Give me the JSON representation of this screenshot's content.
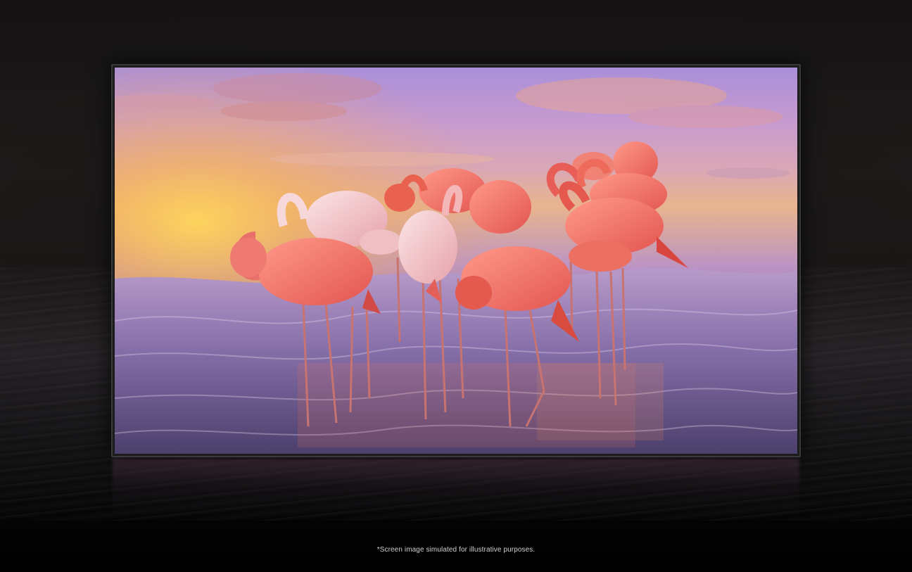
{
  "disclaimer": "*Screen image simulated for illustrative purposes.",
  "product_image": {
    "subject": "flamingos",
    "colors": {
      "sky_top": "#a98fd8",
      "sky_glow": "#f7c25a",
      "flamingo_pink": "#f07a7a",
      "flamingo_light": "#f3c4c8",
      "water": "#6c5c90"
    }
  }
}
